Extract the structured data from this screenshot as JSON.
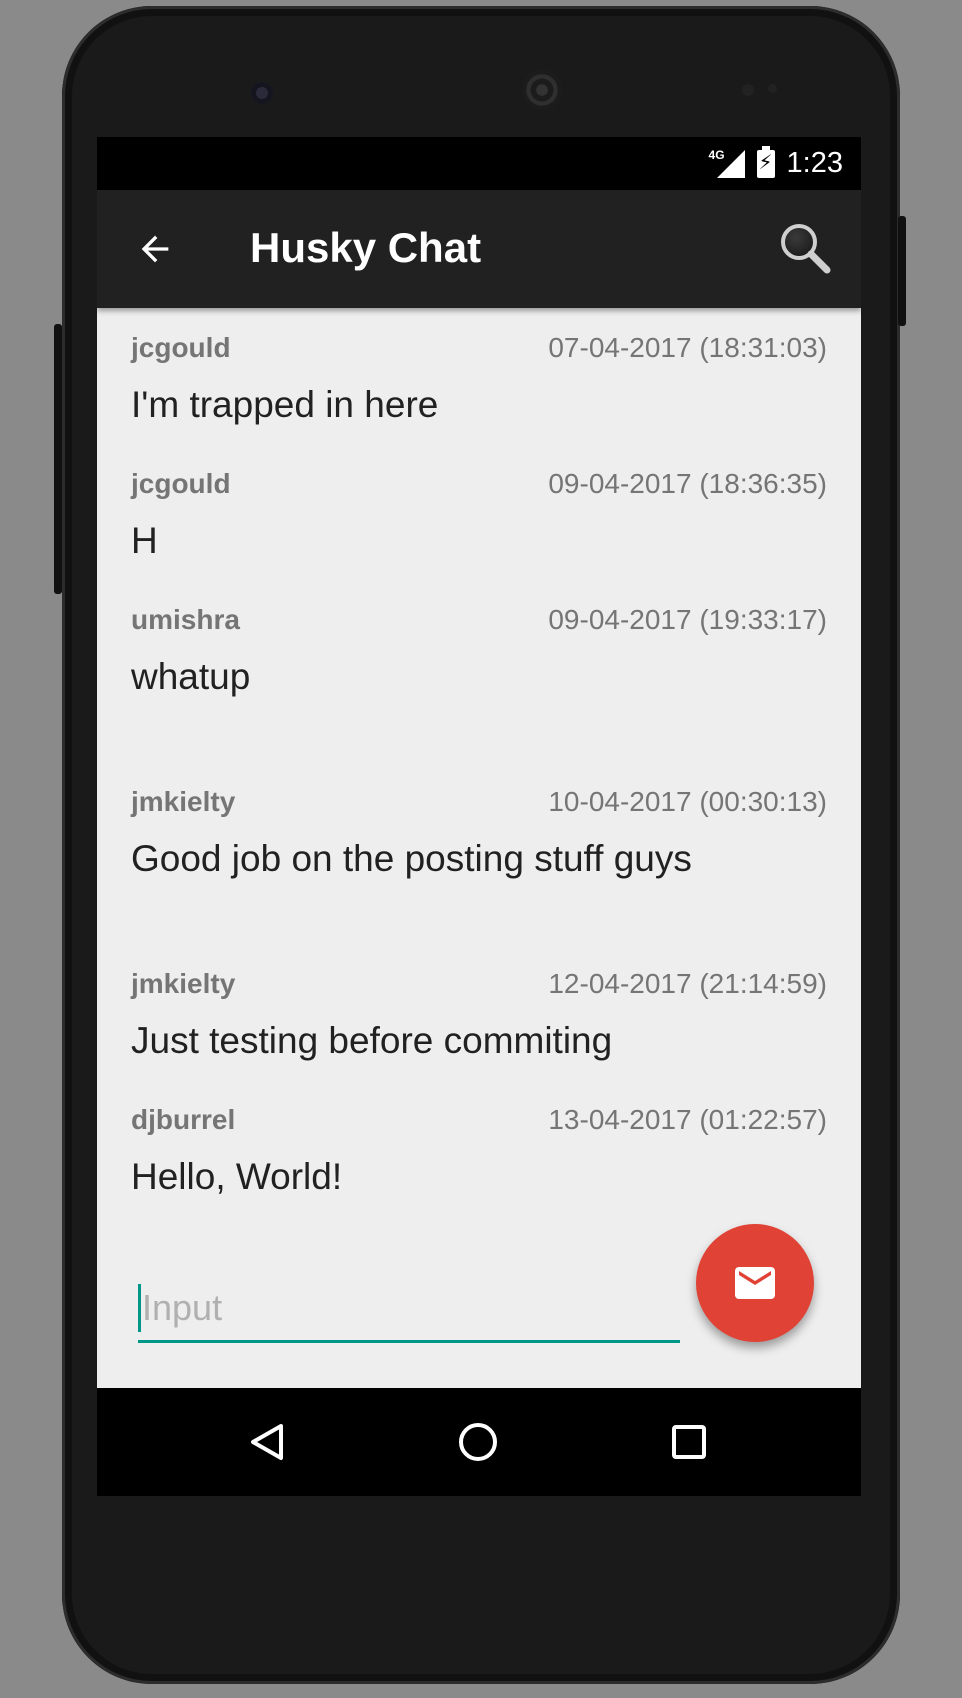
{
  "status_bar": {
    "network": "4G",
    "time": "1:23"
  },
  "app_bar": {
    "title": "Husky Chat",
    "back_icon": "arrow-back-icon",
    "search_icon": "search-icon"
  },
  "messages": [
    {
      "user": "jcgould",
      "timestamp": "07-04-2017 (18:31:03)",
      "text": "I'm trapped in here"
    },
    {
      "user": "jcgould",
      "timestamp": "09-04-2017 (18:36:35)",
      "text": "H"
    },
    {
      "user": "umishra",
      "timestamp": "09-04-2017 (19:33:17)",
      "text": "whatup"
    },
    {
      "user": "jmkielty",
      "timestamp": "10-04-2017 (00:30:13)",
      "text": "Good job on the posting stuff guys"
    },
    {
      "user": "jmkielty",
      "timestamp": "12-04-2017 (21:14:59)",
      "text": "Just testing before commiting"
    },
    {
      "user": "djburrel",
      "timestamp": "13-04-2017 (01:22:57)",
      "text": "Hello, World!"
    }
  ],
  "composer": {
    "placeholder": "Input",
    "value": "",
    "send_icon": "mail-icon"
  },
  "colors": {
    "accent": "#009688",
    "fab": "#e04336",
    "app_bar": "#212121",
    "background": "#eeeeee"
  },
  "nav_bar": {
    "back_icon": "nav-back-icon",
    "home_icon": "nav-home-icon",
    "recents_icon": "nav-recents-icon"
  }
}
